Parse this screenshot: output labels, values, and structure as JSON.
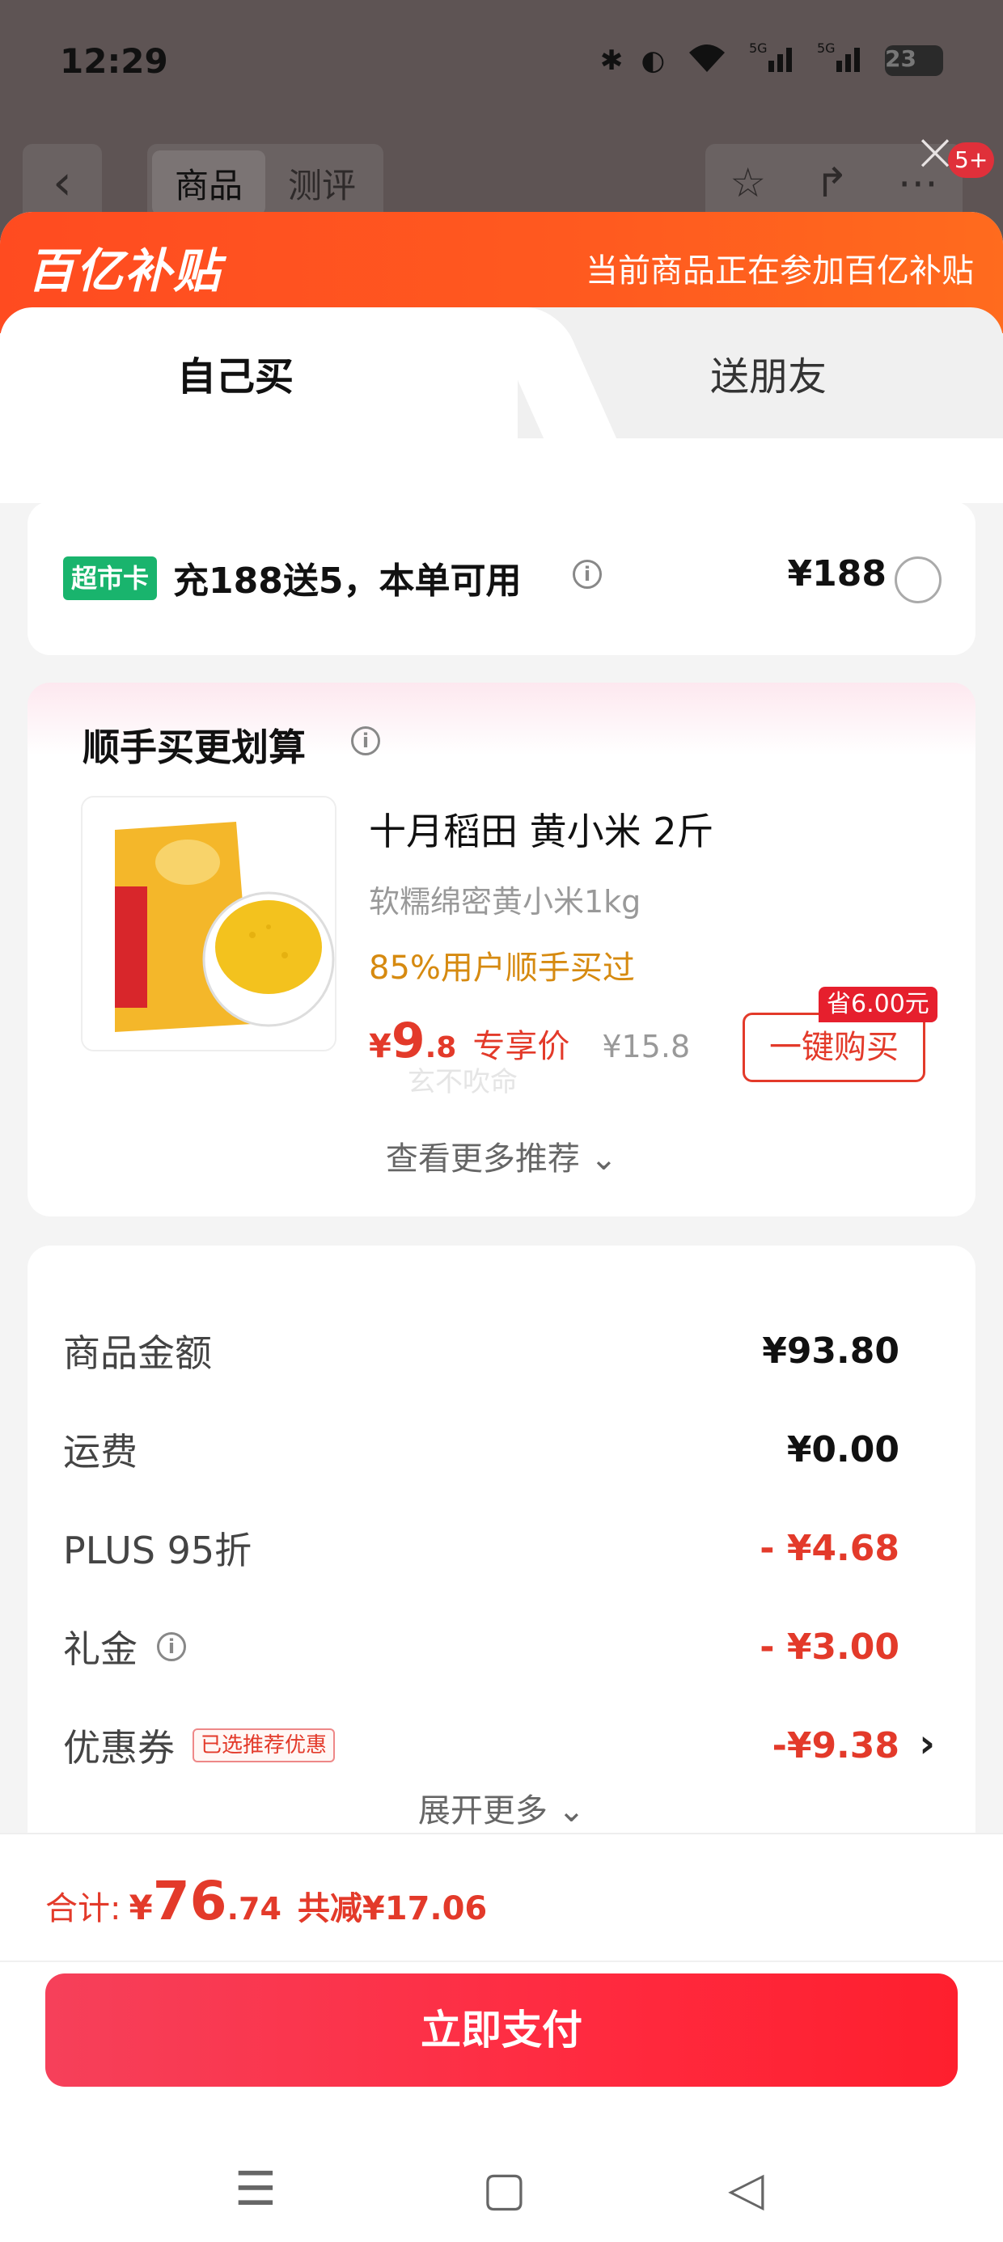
{
  "status_bar": {
    "time": "12:29",
    "battery": "23",
    "icons": [
      "bluetooth-icon",
      "moon-icon",
      "wifi-icon",
      "5g-signal-icon",
      "5g-signal-icon",
      "battery-icon"
    ]
  },
  "background_page": {
    "tabs": [
      "商品",
      "测评"
    ],
    "badge": "5+"
  },
  "banner": {
    "brand": "百亿补贴",
    "note": "当前商品正在参加百亿补贴"
  },
  "mode_tabs": {
    "self": "自己买",
    "gift": "送朋友"
  },
  "market_card": {
    "tag": "超市卡",
    "text": "充188送5，本单可用",
    "price": "¥188"
  },
  "recommend": {
    "title": "顺手买更划算",
    "product_name": "十月稻田 黄小米 2斤",
    "desc": "软糯绵密黄小米1kg",
    "stat": "85%用户顺手买过",
    "price_symbol": "¥",
    "price_int": "9",
    "price_dec": ".8",
    "price_label": "专享价",
    "orig_price": "¥15.8",
    "save_badge": "省6.00元",
    "buy_label": "一键购买",
    "watermark": "玄不吹命",
    "more_label": "查看更多推荐 ⌄"
  },
  "summary": {
    "rows": [
      {
        "label": "商品金额",
        "value": "¥93.80"
      },
      {
        "label": "运费",
        "value": "¥0.00"
      },
      {
        "label": "PLUS 95折",
        "value": "- ¥4.68"
      },
      {
        "label": "礼金",
        "value": "- ¥3.00"
      },
      {
        "label": "优惠券",
        "value": "-¥9.38",
        "chip": "已选推荐优惠"
      }
    ],
    "expand_label": "展开更多 ⌄"
  },
  "footer": {
    "total_label": "合计:",
    "total_symbol": "¥",
    "total_int": "76",
    "total_dec": ".74",
    "total_reduce": "共减¥17.06",
    "pay_label": "立即支付"
  },
  "colors": {
    "accent_red": "#e33a2a",
    "banner_orange": "#ff5a1f",
    "green_tag": "#19b46d",
    "stat_orange": "#d68a10"
  }
}
